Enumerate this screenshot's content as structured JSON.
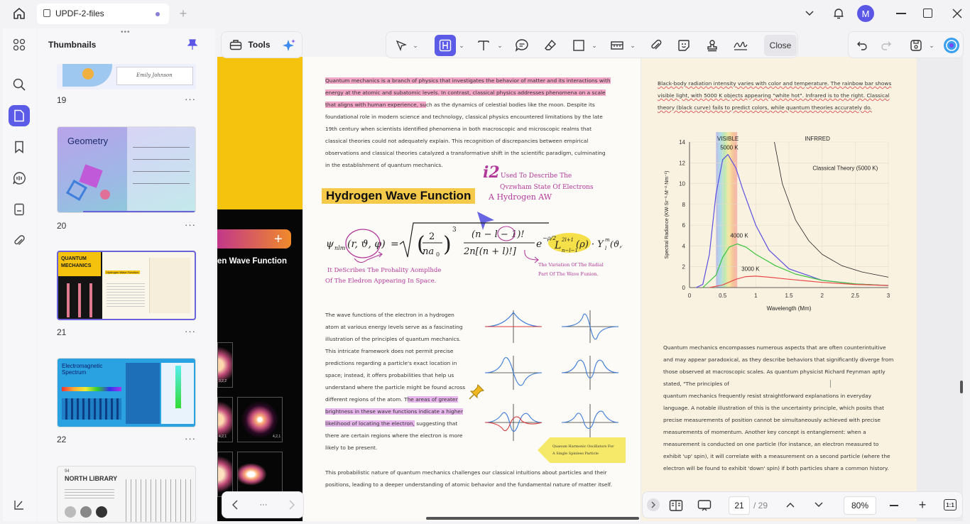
{
  "tab": {
    "title": "UPDF-2-files"
  },
  "user": {
    "avatar": "M"
  },
  "thumbnails": {
    "title": "Thumbnails",
    "items": [
      {
        "num": "19"
      },
      {
        "num": "20",
        "heading": "Geometry"
      },
      {
        "num": "21",
        "heading": "QUANTUM MECHANICS",
        "sub": "Hydrogen Wave Function"
      },
      {
        "num": "22",
        "heading": "Electromagnetic Spectrum"
      },
      {
        "num": "94",
        "heading": "NORTH LIBRARY"
      }
    ]
  },
  "toolbar": {
    "tools_label": "Tools",
    "close_label": "Close"
  },
  "left_page": {
    "title_frag": "en Wave Function",
    "labels": [
      "3,2,2",
      "4,2,1",
      "4,2,1"
    ]
  },
  "center_page": {
    "p1": [
      "Quantum mechanics is a branch of physics that investigates the behavior of matter and its interactions with",
      "energy at the atomic and subatomic levels. In contrast, classical physics addresses phenomena on a scale",
      "that aligns with human experience, su",
      "ch as the dynamics of celestial bodies like the moon. Despite its",
      "foundational role in modern science and technology, classical physics encountered limitations by the late",
      "19th century when scientists identified phenomena in both macroscopic and microscopic realms that",
      "classical theories could not adequately explain. This recognition of discrepancies between empirical",
      "observations and classical theories catalyzed a transformative shift in the scientific paradigm, culminating",
      "in the establishment of quantum mechanics."
    ],
    "heading": "Hydrogen Wave Function",
    "note_i2": "i2",
    "note1": "Used To Describe The",
    "note2": "Qvzwham State Of Electrons",
    "note3": "A Hydrogen AW",
    "note4": "It DeScribes The Prohality Aomplhde",
    "note5": "Of The Eledron Appearing In Space.",
    "note6": "The Variation Of The Radial",
    "note7": "Part Of The Wave Funion.",
    "p2": [
      "The wave functions of the electron in a hydrogen",
      "atom at various energy levels serve as a fascinating",
      "illustration of the principles of quantum mechanics.",
      "This intricate framework does not permit precise",
      "predictions regarding a particle's exact location in",
      "space; instead, it offers probabilities that help us",
      "understand where the particle might be found across",
      "different regions of the atom. T",
      "he areas of greater",
      "brightness in these wave functions indicate a higher",
      "likelihood of locating the electron,",
      " suggesting that",
      "there are certain regions where the electron is more",
      "likely to be present."
    ],
    "sticky1": "Quasum Harmonic Oscillators For",
    "sticky2": "A Single Spinless Particle",
    "p3": [
      "This probabilistic nature of quantum mechanics challenges our classical intuitions about particles and their",
      "positions, leading to a deeper understanding of atomic behavior and the fundamental nature of matter itself."
    ]
  },
  "right_page": {
    "p1": [
      "Black-body radiation intensity varies with color and temperature. The rainbow bar shows",
      "visible light, with 5000 K objects appearing \"white hot\". Infrared is to the right. Classical",
      "theory (black curve) fails to predict colors, while quantum theories accurately do."
    ],
    "p2a": "Quantum mechanics encompasses numerous aspects that are often counterintuitive",
    "p2": [
      "and may appear paradoxical, as they describe behaviors that significantly diverge from",
      "those observed at macroscopic scales. As quantum physicist Richard Feynman aptly",
      "stated, \"The principles of",
      "quantum mechanics frequently resist straightforward explanations in everyday",
      "language. A notable illustration of this is the uncertainty principle, which posits that",
      "precise measurements of position cannot be simultaneously achieved with precise",
      "measurements of momentum. Another key concept is entanglement: when a",
      "measurement is conducted on one particle (for instance, an electron measured to",
      "exhibit 'up' spin), it will correlate with a measurement on a second particle (where the",
      "electron will be found to exhibit 'down' spin) if both particles share a common history."
    ]
  },
  "chart_data": {
    "type": "line",
    "xlabel": "Wavelength (Mm)",
    "ylabel": "Spectral Radiance (KW·Sr⁻¹·M⁻²·Nm⁻¹)",
    "xlim": [
      0,
      3
    ],
    "ylim": [
      0,
      14
    ],
    "xticks": [
      "0",
      "0.5",
      "1",
      "1.5",
      "2",
      "2.5",
      "3"
    ],
    "yticks": [
      "0",
      "2",
      "4",
      "6",
      "8",
      "10",
      "12",
      "14"
    ],
    "region_labels": [
      "VISIBLE",
      "INFRRED"
    ],
    "series": [
      {
        "name": "5000 K",
        "color": "#5a4fe0",
        "x": [
          0.1,
          0.2,
          0.3,
          0.4,
          0.5,
          0.58,
          0.7,
          0.8,
          1.0,
          1.2,
          1.5,
          2.0,
          2.5,
          3.0
        ],
        "y": [
          0,
          0.3,
          3.2,
          9.0,
          12.3,
          12.8,
          11.5,
          9.5,
          6.0,
          3.6,
          1.8,
          0.7,
          0.35,
          0.2
        ]
      },
      {
        "name": "4000 K",
        "color": "#3cc43c",
        "x": [
          0.2,
          0.4,
          0.5,
          0.6,
          0.72,
          0.85,
          1.0,
          1.3,
          1.6,
          2.0,
          2.5,
          3.0
        ],
        "y": [
          0,
          1.2,
          2.9,
          3.9,
          4.2,
          3.9,
          3.2,
          2.1,
          1.3,
          0.7,
          0.35,
          0.2
        ]
      },
      {
        "name": "3000 K",
        "color": "#e84a4a",
        "x": [
          0.3,
          0.5,
          0.7,
          0.85,
          1.0,
          1.2,
          1.5,
          2.0,
          2.5,
          3.0
        ],
        "y": [
          0,
          0.25,
          0.8,
          1.05,
          1.1,
          1.0,
          0.8,
          0.5,
          0.3,
          0.2
        ]
      },
      {
        "name": "Classical Theory (5000 K)",
        "color": "#222222",
        "x": [
          1.28,
          1.4,
          1.6,
          1.8,
          2.0,
          2.3,
          2.6,
          3.0
        ],
        "y": [
          14,
          10,
          6.5,
          4.5,
          3.2,
          2.1,
          1.5,
          1.0
        ]
      }
    ]
  },
  "bottom": {
    "page_current": "21",
    "page_total": "/ 29",
    "zoom": "80%"
  }
}
